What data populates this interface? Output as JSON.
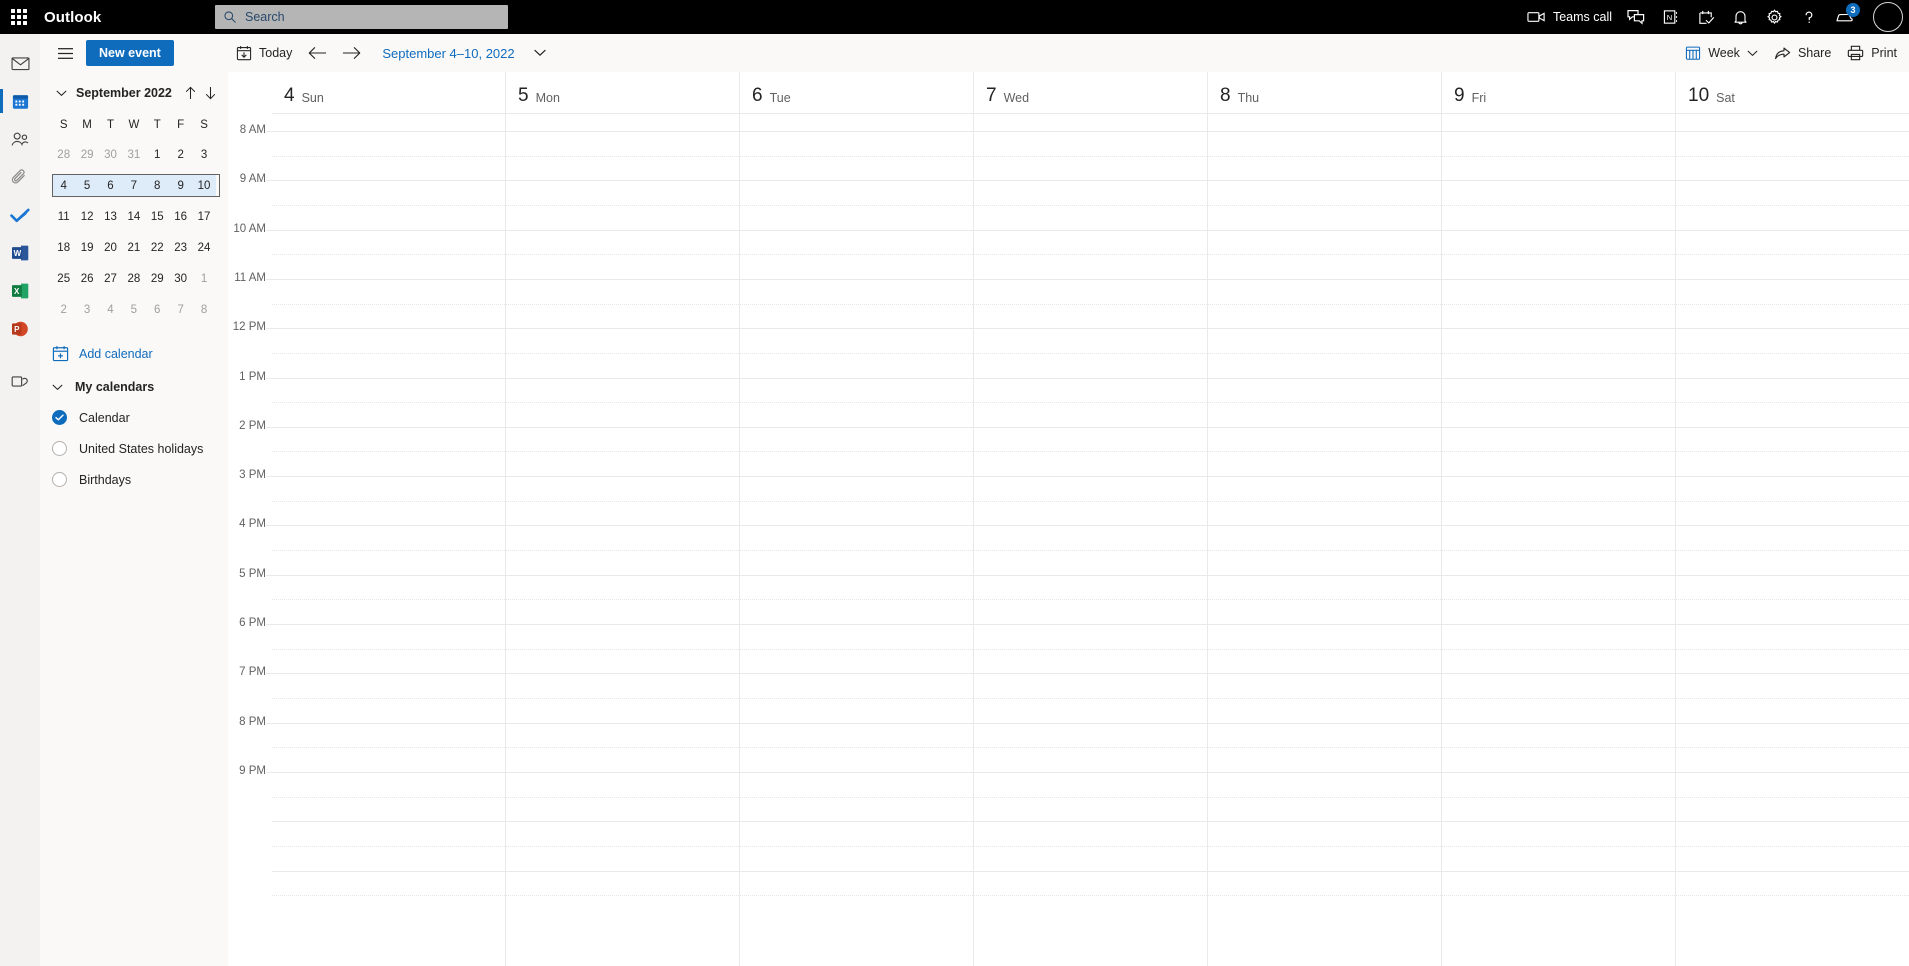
{
  "topbar": {
    "waffle_name": "app-launcher",
    "brand": "Outlook",
    "search_placeholder": "Search",
    "search_value": "",
    "teams_call_label": "Teams call",
    "notification_badge": "3",
    "blur_text": "",
    "icons": [
      {
        "name": "video-camera-icon",
        "label": "Teams call"
      },
      {
        "name": "chat-icon",
        "label": ""
      },
      {
        "name": "onenote-icon",
        "label": ""
      },
      {
        "name": "tasks-check-icon",
        "label": ""
      },
      {
        "name": "bell-icon",
        "label": ""
      },
      {
        "name": "gear-icon",
        "label": ""
      },
      {
        "name": "help-icon",
        "label": ""
      },
      {
        "name": "shopping-bag-icon",
        "label": ""
      }
    ]
  },
  "rail": {
    "items": [
      {
        "name": "mail",
        "label": "Mail",
        "active": false
      },
      {
        "name": "calendar",
        "label": "Calendar",
        "active": true
      },
      {
        "name": "people",
        "label": "People",
        "active": false
      },
      {
        "name": "files",
        "label": "Files",
        "active": false
      },
      {
        "name": "todo",
        "label": "To Do",
        "active": false
      },
      {
        "name": "word",
        "label": "Word",
        "active": false
      },
      {
        "name": "excel",
        "label": "Excel",
        "active": false
      },
      {
        "name": "powerpoint",
        "label": "PowerPoint",
        "active": false
      },
      {
        "name": "apps",
        "label": "Apps",
        "active": false
      }
    ]
  },
  "leftpane": {
    "new_event_label": "New event",
    "minicalendar": {
      "title": "September 2022",
      "dow": [
        "S",
        "M",
        "T",
        "W",
        "T",
        "F",
        "S"
      ],
      "weeks": [
        {
          "selected": false,
          "days": [
            {
              "n": "28",
              "muted": true
            },
            {
              "n": "29",
              "muted": true
            },
            {
              "n": "30",
              "muted": true
            },
            {
              "n": "31",
              "muted": true
            },
            {
              "n": "1",
              "muted": false
            },
            {
              "n": "2",
              "muted": false
            },
            {
              "n": "3",
              "muted": false
            }
          ]
        },
        {
          "selected": true,
          "days": [
            {
              "n": "4",
              "muted": false
            },
            {
              "n": "5",
              "muted": false
            },
            {
              "n": "6",
              "muted": false
            },
            {
              "n": "7",
              "muted": false
            },
            {
              "n": "8",
              "muted": false
            },
            {
              "n": "9",
              "muted": false
            },
            {
              "n": "10",
              "muted": false
            }
          ]
        },
        {
          "selected": false,
          "days": [
            {
              "n": "11",
              "muted": false
            },
            {
              "n": "12",
              "muted": false
            },
            {
              "n": "13",
              "muted": false
            },
            {
              "n": "14",
              "muted": false
            },
            {
              "n": "15",
              "muted": false
            },
            {
              "n": "16",
              "muted": false
            },
            {
              "n": "17",
              "muted": false
            }
          ]
        },
        {
          "selected": false,
          "days": [
            {
              "n": "18",
              "muted": false
            },
            {
              "n": "19",
              "muted": false
            },
            {
              "n": "20",
              "muted": false
            },
            {
              "n": "21",
              "muted": false
            },
            {
              "n": "22",
              "muted": false
            },
            {
              "n": "23",
              "muted": false
            },
            {
              "n": "24",
              "muted": false
            }
          ]
        },
        {
          "selected": false,
          "days": [
            {
              "n": "25",
              "muted": false
            },
            {
              "n": "26",
              "muted": false
            },
            {
              "n": "27",
              "muted": false
            },
            {
              "n": "28",
              "muted": false
            },
            {
              "n": "29",
              "muted": false
            },
            {
              "n": "30",
              "muted": false
            },
            {
              "n": "1",
              "muted": true
            }
          ]
        },
        {
          "selected": false,
          "days": [
            {
              "n": "2",
              "muted": true
            },
            {
              "n": "3",
              "muted": true
            },
            {
              "n": "4",
              "muted": true
            },
            {
              "n": "5",
              "muted": true
            },
            {
              "n": "6",
              "muted": true
            },
            {
              "n": "7",
              "muted": true
            },
            {
              "n": "8",
              "muted": true
            }
          ]
        }
      ]
    },
    "add_calendar_label": "Add calendar",
    "my_calendars_label": "My calendars",
    "calendars": [
      {
        "label": "Calendar",
        "checked": true
      },
      {
        "label": "United States holidays",
        "checked": false
      },
      {
        "label": "Birthdays",
        "checked": false
      }
    ]
  },
  "commandbar": {
    "today_label": "Today",
    "back_name": "previous-period",
    "forward_name": "next-period",
    "date_range": "September 4–10, 2022",
    "view_label": "Week",
    "share_label": "Share",
    "print_label": "Print"
  },
  "calendar": {
    "days": [
      {
        "num": "4",
        "dow": "Sun"
      },
      {
        "num": "5",
        "dow": "Mon"
      },
      {
        "num": "6",
        "dow": "Tue"
      },
      {
        "num": "7",
        "dow": "Wed"
      },
      {
        "num": "8",
        "dow": "Thu"
      },
      {
        "num": "9",
        "dow": "Fri"
      },
      {
        "num": "10",
        "dow": "Sat"
      }
    ],
    "time_labels": [
      "8 AM",
      "9 AM",
      "10 AM",
      "11 AM",
      "12 PM",
      "1 PM",
      "2 PM",
      "3 PM",
      "4 PM",
      "5 PM",
      "6 PM",
      "7 PM",
      "8 PM",
      "9 PM"
    ],
    "events": []
  },
  "colors": {
    "accent": "#0f6cbd",
    "topbar_bg": "#000000",
    "pane_bg": "#faf9f8",
    "rail_bg": "#f3f2f1",
    "grid_line": "#ebe9e7",
    "selected_week": "#deecf9"
  }
}
